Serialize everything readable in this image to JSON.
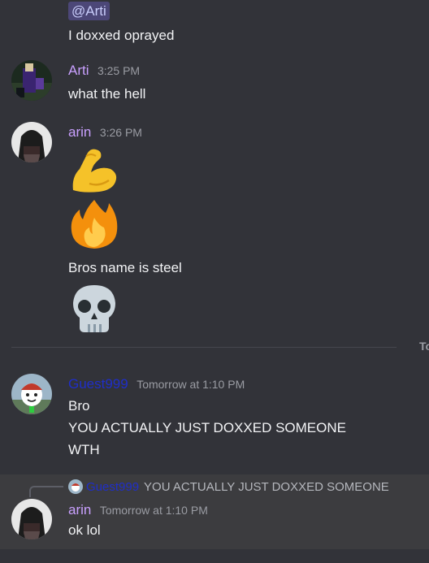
{
  "messages": {
    "m0": {
      "mention": "@Arti",
      "text": "I doxxed oprayed"
    },
    "m1": {
      "author": "Arti",
      "author_color": "#c9a0ff",
      "timestamp": "3:25 PM",
      "text": "what the hell"
    },
    "m2": {
      "author": "arin",
      "author_color": "#c9a0ff",
      "timestamp": "3:26 PM",
      "emoji1": "flexed-biceps-emoji",
      "emoji2": "fire-emoji",
      "text": "Bros name is steel",
      "emoji3": "skull-emoji"
    },
    "divider": {
      "label": "To"
    },
    "m3": {
      "author": "Guest999",
      "author_color": "#1f2ec9",
      "timestamp": "Tomorrow at 1:10 PM",
      "lines": [
        "Bro",
        "YOU ACTUALLY JUST DOXXED SOMEONE",
        "WTH"
      ]
    },
    "m4": {
      "reply_author": "Guest999",
      "reply_text": "YOU ACTUALLY JUST DOXXED SOMEONE",
      "author": "arin",
      "author_color": "#c9a0ff",
      "timestamp": "Tomorrow at 1:10 PM",
      "text": "ok lol"
    }
  }
}
